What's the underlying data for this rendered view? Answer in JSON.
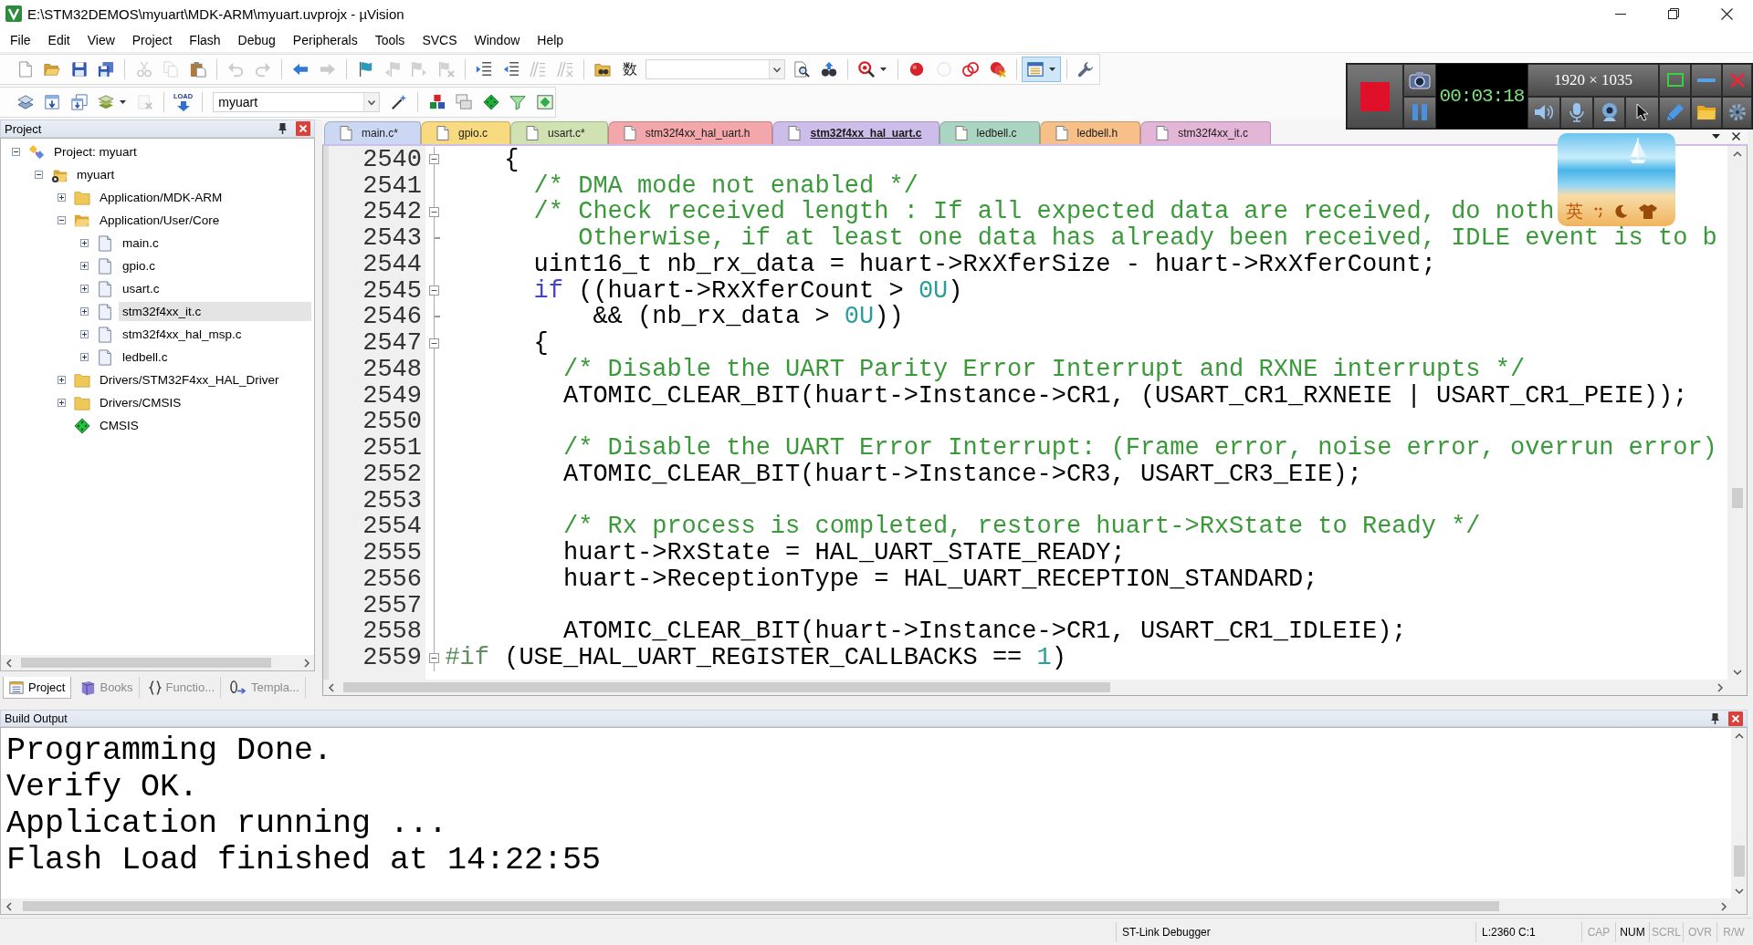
{
  "window": {
    "title": "E:\\STM32DEMOS\\myuart\\MDK-ARM\\myuart.uvprojx - µVision"
  },
  "menu": [
    "File",
    "Edit",
    "View",
    "Project",
    "Flash",
    "Debug",
    "Peripherals",
    "Tools",
    "SVCS",
    "Window",
    "Help"
  ],
  "toolbar_1": [
    {
      "kind": "new",
      "disabled": false,
      "pressed": false
    },
    {
      "kind": "open",
      "disabled": false,
      "pressed": false
    },
    {
      "kind": "save",
      "disabled": false,
      "pressed": false
    },
    {
      "kind": "save_all",
      "disabled": false,
      "pressed": false
    },
    {
      "kind": "separator"
    },
    {
      "kind": "cut",
      "disabled": true,
      "pressed": false
    },
    {
      "kind": "copy",
      "disabled": true,
      "pressed": false
    },
    {
      "kind": "paste",
      "disabled": false,
      "pressed": false
    },
    {
      "kind": "separator"
    },
    {
      "kind": "undo",
      "disabled": true,
      "pressed": false
    },
    {
      "kind": "redo",
      "disabled": true,
      "pressed": false
    },
    {
      "kind": "separator"
    },
    {
      "kind": "back",
      "disabled": false,
      "pressed": false
    },
    {
      "kind": "forward",
      "disabled": true,
      "pressed": false
    },
    {
      "kind": "separator"
    },
    {
      "kind": "bookmark",
      "disabled": false,
      "pressed": false
    },
    {
      "kind": "bookmark_prev",
      "disabled": true,
      "pressed": false
    },
    {
      "kind": "bookmark_next",
      "disabled": true,
      "pressed": false
    },
    {
      "kind": "bookmark_clear",
      "disabled": true,
      "pressed": false
    },
    {
      "kind": "separator"
    },
    {
      "kind": "indent",
      "disabled": false,
      "pressed": false
    },
    {
      "kind": "unindent",
      "disabled": false,
      "pressed": false
    },
    {
      "kind": "comment",
      "disabled": true,
      "pressed": false
    },
    {
      "kind": "uncomment",
      "disabled": true,
      "pressed": false
    },
    {
      "kind": "separator"
    },
    {
      "kind": "find_in_files",
      "disabled": false,
      "pressed": false
    },
    {
      "kind": "glyph",
      "text": "数",
      "disabled": false,
      "pressed": false
    },
    {
      "kind": "combo"
    },
    {
      "kind": "find",
      "disabled": false,
      "pressed": false
    },
    {
      "kind": "incremental_find",
      "disabled": false,
      "pressed": false
    },
    {
      "kind": "separator"
    },
    {
      "kind": "debug",
      "disabled": false,
      "pressed": false
    },
    {
      "kind": "separator"
    },
    {
      "kind": "breakpoint",
      "disabled": false,
      "pressed": false
    },
    {
      "kind": "breakpoint_enable",
      "disabled": true,
      "pressed": false
    },
    {
      "kind": "breakpoint_disable_all",
      "disabled": false,
      "pressed": false
    },
    {
      "kind": "breakpoint_kill_all",
      "disabled": false,
      "pressed": false
    },
    {
      "kind": "separator"
    },
    {
      "kind": "window",
      "disabled": false,
      "pressed": true
    },
    {
      "kind": "separator"
    },
    {
      "kind": "configure",
      "disabled": false,
      "pressed": false
    }
  ],
  "toolbar_2": [
    {
      "kind": "translate",
      "disabled": false,
      "pressed": false
    },
    {
      "kind": "build",
      "disabled": false,
      "pressed": false
    },
    {
      "kind": "rebuild",
      "disabled": false,
      "pressed": false
    },
    {
      "kind": "batch_build",
      "disabled": false,
      "pressed": false
    },
    {
      "kind": "stop_build",
      "disabled": true,
      "pressed": false
    },
    {
      "kind": "separator"
    },
    {
      "kind": "download",
      "caption": "LOAD",
      "disabled": false,
      "pressed": false
    },
    {
      "kind": "separator"
    },
    {
      "kind": "combo",
      "value": "myuart"
    },
    {
      "kind": "options",
      "disabled": false,
      "pressed": false
    },
    {
      "kind": "separator"
    },
    {
      "kind": "manage_items",
      "disabled": false,
      "pressed": false
    },
    {
      "kind": "multi_project",
      "disabled": false,
      "pressed": false
    },
    {
      "kind": "rte",
      "disabled": false,
      "pressed": false
    },
    {
      "kind": "packs",
      "disabled": false,
      "pressed": false
    },
    {
      "kind": "pack_installer",
      "disabled": false,
      "pressed": false
    }
  ],
  "project_panel": {
    "title": "Project",
    "tree": [
      {
        "kind": "project",
        "label": "Project: myuart",
        "expanded": true,
        "selected": false,
        "children": [
          {
            "kind": "target",
            "label": "myuart",
            "expanded": true,
            "selected": false,
            "children": [
              {
                "kind": "group",
                "label": "Application/MDK-ARM",
                "expanded": false,
                "selected": false
              },
              {
                "kind": "group",
                "label": "Application/User/Core",
                "expanded": true,
                "selected": false,
                "children": [
                  {
                    "kind": "file",
                    "label": "main.c",
                    "expanded": false,
                    "selected": false
                  },
                  {
                    "kind": "file",
                    "label": "gpio.c",
                    "expanded": false,
                    "selected": false
                  },
                  {
                    "kind": "file",
                    "label": "usart.c",
                    "expanded": false,
                    "selected": false
                  },
                  {
                    "kind": "file",
                    "label": "stm32f4xx_it.c",
                    "expanded": false,
                    "selected": true
                  },
                  {
                    "kind": "file",
                    "label": "stm32f4xx_hal_msp.c",
                    "expanded": false,
                    "selected": false
                  },
                  {
                    "kind": "file",
                    "label": "ledbell.c",
                    "expanded": false,
                    "selected": false
                  }
                ]
              },
              {
                "kind": "group",
                "label": "Drivers/STM32F4xx_HAL_Driver",
                "expanded": false,
                "selected": false
              },
              {
                "kind": "group",
                "label": "Drivers/CMSIS",
                "expanded": false,
                "selected": false
              },
              {
                "kind": "component",
                "label": "CMSIS",
                "selected": false
              }
            ]
          }
        ]
      }
    ],
    "tabs": [
      {
        "kind": "project",
        "label": "Project",
        "selected": true
      },
      {
        "kind": "books",
        "label": "Books",
        "selected": false
      },
      {
        "kind": "functions",
        "label": "Functio...",
        "selected": false
      },
      {
        "kind": "templates",
        "label": "Templa...",
        "selected": false
      }
    ]
  },
  "editor": {
    "tabs": [
      {
        "label": "main.c*",
        "color": "#cbd7f3",
        "selected": false
      },
      {
        "label": "gpio.c",
        "color": "#f8da80",
        "selected": false
      },
      {
        "label": "usart.c*",
        "color": "#d1e2b2",
        "selected": false
      },
      {
        "label": "stm32f4xx_hal_uart.h",
        "color": "#f3a7ab",
        "selected": false
      },
      {
        "label": "stm32f4xx_hal_uart.c",
        "color": "#cdbdea",
        "selected": true
      },
      {
        "label": "ledbell.c",
        "color": "#abd5c3",
        "selected": false
      },
      {
        "label": "ledbell.h",
        "color": "#f7c088",
        "selected": false
      },
      {
        "label": "stm32f4xx_it.c",
        "color": "#e3b5d6",
        "selected": false
      }
    ],
    "lines": [
      {
        "number": "2540",
        "kind": "opener",
        "segments": [
          {
            "kind": "plain",
            "text": "    {"
          }
        ]
      },
      {
        "number": "2541",
        "kind": "plain",
        "segments": [
          {
            "kind": "comment",
            "text": "      /* DMA mode not enabled */"
          }
        ]
      },
      {
        "number": "2542",
        "kind": "opener",
        "segments": [
          {
            "kind": "comment",
            "text": "      /* Check received length : If all expected data are received, do noth"
          }
        ]
      },
      {
        "number": "2543",
        "kind": "closer",
        "segments": [
          {
            "kind": "comment",
            "text": "         Otherwise, if at least one data has already been received, IDLE event is to b"
          }
        ]
      },
      {
        "number": "2544",
        "kind": "plain",
        "segments": [
          {
            "kind": "plain",
            "text": "      uint16_t nb_rx_data = huart->RxXferSize - huart->RxXferCount;"
          }
        ]
      },
      {
        "number": "2545",
        "kind": "opener",
        "segments": [
          {
            "kind": "keyword",
            "text": "      if"
          },
          {
            "kind": "plain",
            "text": " ((huart->RxXferCount > "
          },
          {
            "kind": "number",
            "text": "0U"
          },
          {
            "kind": "plain",
            "text": ")"
          }
        ]
      },
      {
        "number": "2546",
        "kind": "closer",
        "segments": [
          {
            "kind": "plain",
            "text": "          && (nb_rx_data > "
          },
          {
            "kind": "number",
            "text": "0U"
          },
          {
            "kind": "plain",
            "text": "))"
          }
        ]
      },
      {
        "number": "2547",
        "kind": "opener",
        "segments": [
          {
            "kind": "plain",
            "text": "      {"
          }
        ]
      },
      {
        "number": "2548",
        "kind": "plain",
        "segments": [
          {
            "kind": "comment",
            "text": "        /* Disable the UART Parity Error Interrupt and RXNE interrupts */"
          }
        ]
      },
      {
        "number": "2549",
        "kind": "plain",
        "segments": [
          {
            "kind": "plain",
            "text": "        ATOMIC_CLEAR_BIT(huart->Instance->CR1, (USART_CR1_RXNEIE | USART_CR1_PEIE));"
          }
        ]
      },
      {
        "number": "2550",
        "kind": "plain"
      },
      {
        "number": "2551",
        "kind": "plain",
        "segments": [
          {
            "kind": "comment",
            "text": "        /* Disable the UART Error Interrupt: (Frame error, noise error, overrun error)"
          }
        ]
      },
      {
        "number": "2552",
        "kind": "plain",
        "segments": [
          {
            "kind": "plain",
            "text": "        ATOMIC_CLEAR_BIT(huart->Instance->CR3, USART_CR3_EIE);"
          }
        ]
      },
      {
        "number": "2553",
        "kind": "plain"
      },
      {
        "number": "2554",
        "kind": "plain",
        "segments": [
          {
            "kind": "comment",
            "text": "        /* Rx process is completed, restore huart->RxState to Ready */"
          }
        ]
      },
      {
        "number": "2555",
        "kind": "plain",
        "segments": [
          {
            "kind": "plain",
            "text": "        huart->RxState = HAL_UART_STATE_READY;"
          }
        ]
      },
      {
        "number": "2556",
        "kind": "plain",
        "segments": [
          {
            "kind": "plain",
            "text": "        huart->ReceptionType = HAL_UART_RECEPTION_STANDARD;"
          }
        ]
      },
      {
        "number": "2557",
        "kind": "plain"
      },
      {
        "number": "2558",
        "kind": "plain",
        "segments": [
          {
            "kind": "plain",
            "text": "        ATOMIC_CLEAR_BIT(huart->Instance->CR1, USART_CR1_IDLEIE);"
          }
        ]
      },
      {
        "number": "2559",
        "kind": "opener",
        "segments": [
          {
            "kind": "preprocessor",
            "text": "#if"
          },
          {
            "kind": "plain",
            "text": " (USE_HAL_UART_REGISTER_CALLBACKS == "
          },
          {
            "kind": "number",
            "text": "1"
          },
          {
            "kind": "plain",
            "text": ")"
          }
        ]
      }
    ]
  },
  "build_output": {
    "title": "Build Output",
    "lines": [
      "Programming Done.",
      "Verify OK.",
      "Application running ...",
      "Flash Load finished at 14:22:55"
    ]
  },
  "status_bar": {
    "debugger": "ST-Link Debugger",
    "position": "L:2360 C:1",
    "indicators": [
      {
        "label": "CAP",
        "on": false
      },
      {
        "label": "NUM",
        "on": true
      },
      {
        "label": "SCRL",
        "on": false
      },
      {
        "label": "OVR",
        "on": false
      },
      {
        "label": "R/W",
        "on": false
      }
    ]
  },
  "recorder": {
    "timer": "00:03:18",
    "resolution": "1920 × 1035"
  },
  "input_method": {
    "mode": "英"
  }
}
